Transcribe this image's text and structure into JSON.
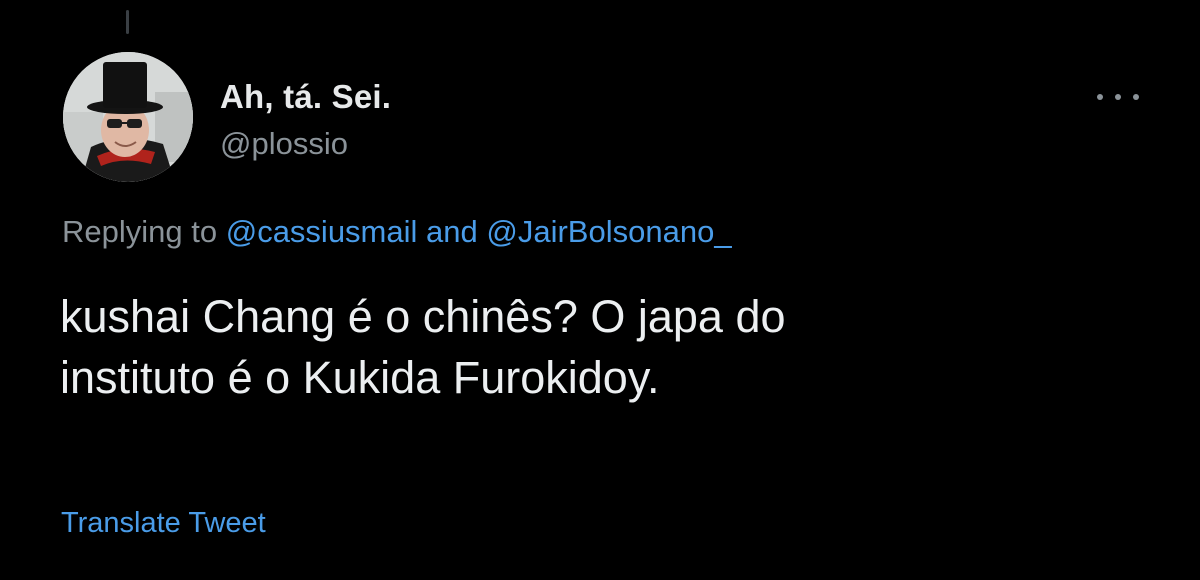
{
  "tweet": {
    "author": {
      "display_name": "Ah, tá. Sei.",
      "handle": "@plossio"
    },
    "replying": {
      "prefix": "Replying to",
      "mention_1": "@cassiusmail",
      "connector": "and",
      "mention_2": "@JairBolsonano_"
    },
    "text_lines": [
      "kushai Chang é o chinês? O japa do",
      "instituto é o Kukida Furokidoy."
    ],
    "translate_label": "Translate Tweet",
    "more_icon": "more-horizontal-icon"
  },
  "colors": {
    "background": "#000000",
    "primary_text": "#e7e9ea",
    "secondary_text": "#8b9399",
    "link": "#4a9ce8"
  }
}
